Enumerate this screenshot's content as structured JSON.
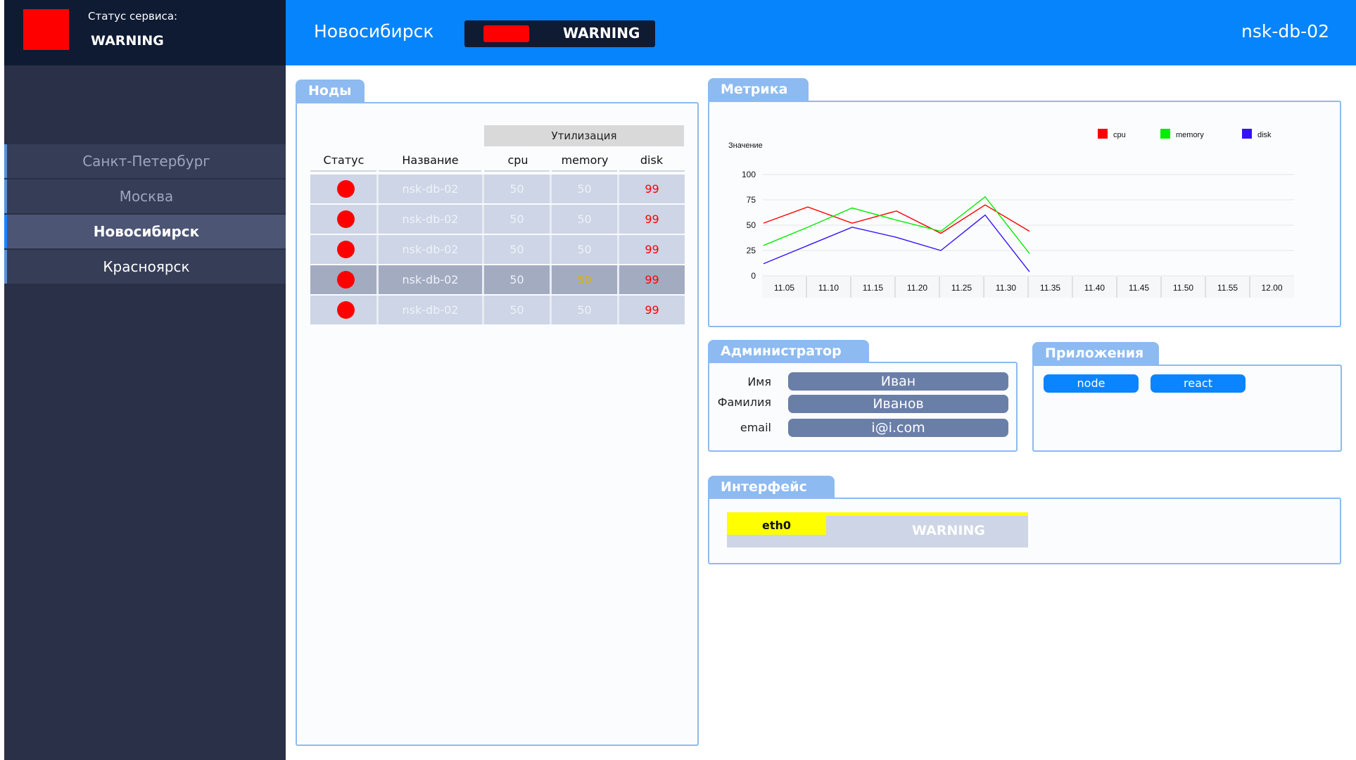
{
  "service_status": {
    "caption": "Статус сервиса:",
    "value": "WARNING",
    "color": "#ff0000"
  },
  "sidebar": {
    "cities": [
      {
        "label": "Санкт-Петербург"
      },
      {
        "label": "Москва"
      },
      {
        "label": "Новосибирск",
        "active": true
      },
      {
        "label": "Красноярск"
      }
    ]
  },
  "header": {
    "city": "Новосибирск",
    "status": "WARNING",
    "status_color": "#ff0000",
    "host": "nsk-db-02",
    "background": "#0584fc"
  },
  "nodes": {
    "tab": "Ноды",
    "utilization_label": "Утилизация",
    "columns": [
      "Статус",
      "Название",
      "cpu",
      "memory",
      "disk"
    ],
    "rows": [
      {
        "name": "nsk-db-02",
        "cpu": "50",
        "memory": "50",
        "disk": "99"
      },
      {
        "name": "nsk-db-02",
        "cpu": "50",
        "memory": "50",
        "disk": "99"
      },
      {
        "name": "nsk-db-02",
        "cpu": "50",
        "memory": "50",
        "disk": "99"
      },
      {
        "name": "nsk-db-02",
        "cpu": "50",
        "memory": "50",
        "disk": "99"
      },
      {
        "name": "nsk-db-02",
        "cpu": "50",
        "memory": "50",
        "disk": "99"
      }
    ]
  },
  "metrics": {
    "tab": "Метрика",
    "ylabel": "Значение"
  },
  "chart_data": {
    "type": "line",
    "title": "",
    "xlabel": "",
    "ylabel": "Значение",
    "x": [
      "11.05",
      "11.10",
      "11.15",
      "11.20",
      "11.25",
      "11.30",
      "11.35",
      "11.40",
      "11.45",
      "11.50",
      "11.55",
      "12.00"
    ],
    "yticks": [
      0,
      25,
      50,
      75,
      100
    ],
    "ylim": [
      0,
      100
    ],
    "legend_position": "top-right",
    "series": [
      {
        "name": "cpu",
        "color": "#ff0000",
        "values": [
          52,
          68,
          52,
          64,
          42,
          70,
          44
        ]
      },
      {
        "name": "memory",
        "color": "#00ee00",
        "values": [
          30,
          48,
          67,
          55,
          44,
          78,
          22
        ]
      },
      {
        "name": "disk",
        "color": "#3311ff",
        "values": [
          12,
          30,
          48,
          38,
          25,
          60,
          4
        ]
      }
    ]
  },
  "admin": {
    "tab": "Администратор",
    "fields": [
      {
        "label": "Имя",
        "value": "Иван"
      },
      {
        "label": "Фамилия",
        "value": "Иванов"
      },
      {
        "label": "email",
        "value": "i@i.com"
      }
    ]
  },
  "apps": {
    "tab": "Приложения",
    "items": [
      "node",
      "react"
    ]
  },
  "interface": {
    "tab": "Интерфейс",
    "name": "eth0",
    "status": "WARNING",
    "status_color": "#ffff00"
  }
}
